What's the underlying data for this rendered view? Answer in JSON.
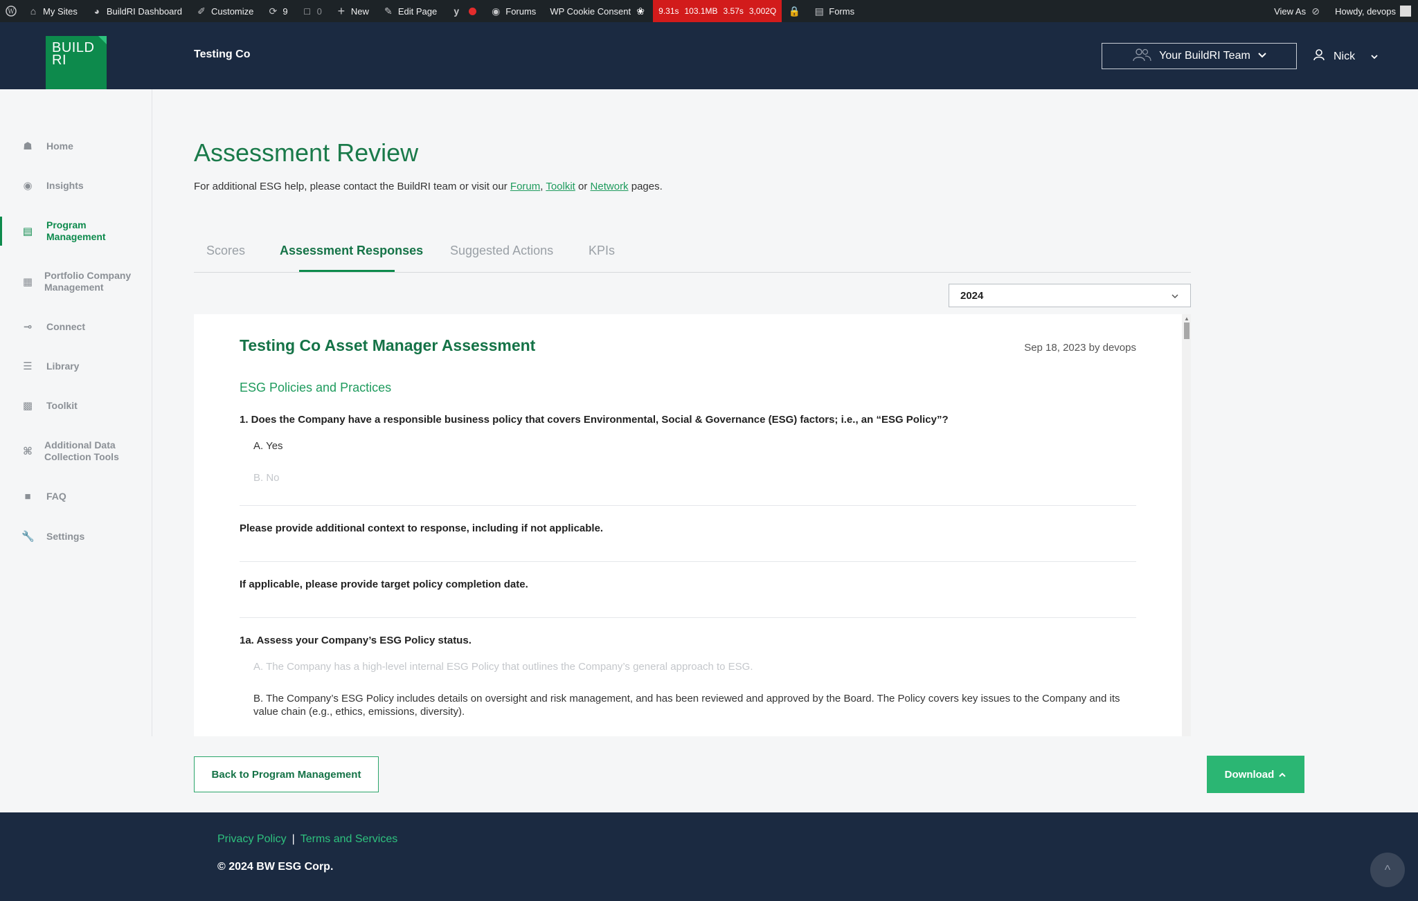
{
  "admin_bar": {
    "my_sites": "My Sites",
    "dashboard": "BuildRI Dashboard",
    "customize": "Customize",
    "updates": "9",
    "comments": "0",
    "new": "New",
    "edit_page": "Edit Page",
    "forums": "Forums",
    "cookie_consent": "WP Cookie Consent",
    "perf": [
      "9.31s",
      "103.1MB",
      "3.57s",
      "3,002Q"
    ],
    "forms": "Forms",
    "view_as": "View As",
    "howdy": "Howdy, devops"
  },
  "header": {
    "logo_line1": "BUILD",
    "logo_line2": "RI",
    "company": "Testing Co",
    "team_button": "Your BuildRI Team",
    "user_name": "Nick"
  },
  "sidebar": {
    "items": [
      {
        "label": "Home",
        "icon": "home-icon"
      },
      {
        "label": "Insights",
        "icon": "globe-icon"
      },
      {
        "label": "Program Management",
        "icon": "program-icon",
        "active": true
      },
      {
        "label": "Portfolio Company Management",
        "icon": "grid-icon"
      },
      {
        "label": "Connect",
        "icon": "connect-icon"
      },
      {
        "label": "Library",
        "icon": "layers-icon"
      },
      {
        "label": "Toolkit",
        "icon": "toolkit-icon"
      },
      {
        "label": "Additional Data Collection Tools",
        "icon": "command-icon"
      },
      {
        "label": "FAQ",
        "icon": "faq-icon"
      },
      {
        "label": "Settings",
        "icon": "wrench-icon"
      }
    ]
  },
  "main": {
    "title": "Assessment Review",
    "help_prefix": "For additional ESG help, please contact the BuildRI team or visit our ",
    "help_forum": "Forum",
    "help_comma": ", ",
    "help_toolkit": "Toolkit",
    "help_or": " or ",
    "help_network": "Network",
    "help_suffix": " pages.",
    "tabs": [
      "Scores",
      "Assessment Responses",
      "Suggested Actions",
      "KPIs"
    ],
    "year": "2024"
  },
  "assessment": {
    "title": "Testing Co Asset Manager Assessment",
    "meta": "Sep 18, 2023 by devops",
    "section": "ESG Policies and Practices",
    "q1": "1. Does the Company have a responsible business policy that covers Environmental, Social & Governance (ESG) factors; i.e., an “ESG Policy”?",
    "q1_a": "A. Yes",
    "q1_b": "B. No",
    "q_context": "Please provide additional context to response, including if not applicable.",
    "q_target": "If applicable, please provide target policy completion date.",
    "q1a": "1a. Assess your Company’s ESG Policy status.",
    "q1a_a": "A. The Company has a high-level internal ESG Policy that outlines the Company’s general approach to ESG.",
    "q1a_b": "B. The Company’s ESG Policy includes details on oversight and risk management, and has been reviewed and approved by the Board. The Policy covers key issues to the Company and its value chain (e.g., ethics, emissions, diversity)."
  },
  "actions": {
    "back": "Back to Program Management",
    "download": "Download"
  },
  "footer": {
    "privacy": "Privacy Policy",
    "sep": "|",
    "terms": "Terms and Services",
    "copyright": "© 2024 BW ESG Corp.",
    "to_top": "^"
  }
}
